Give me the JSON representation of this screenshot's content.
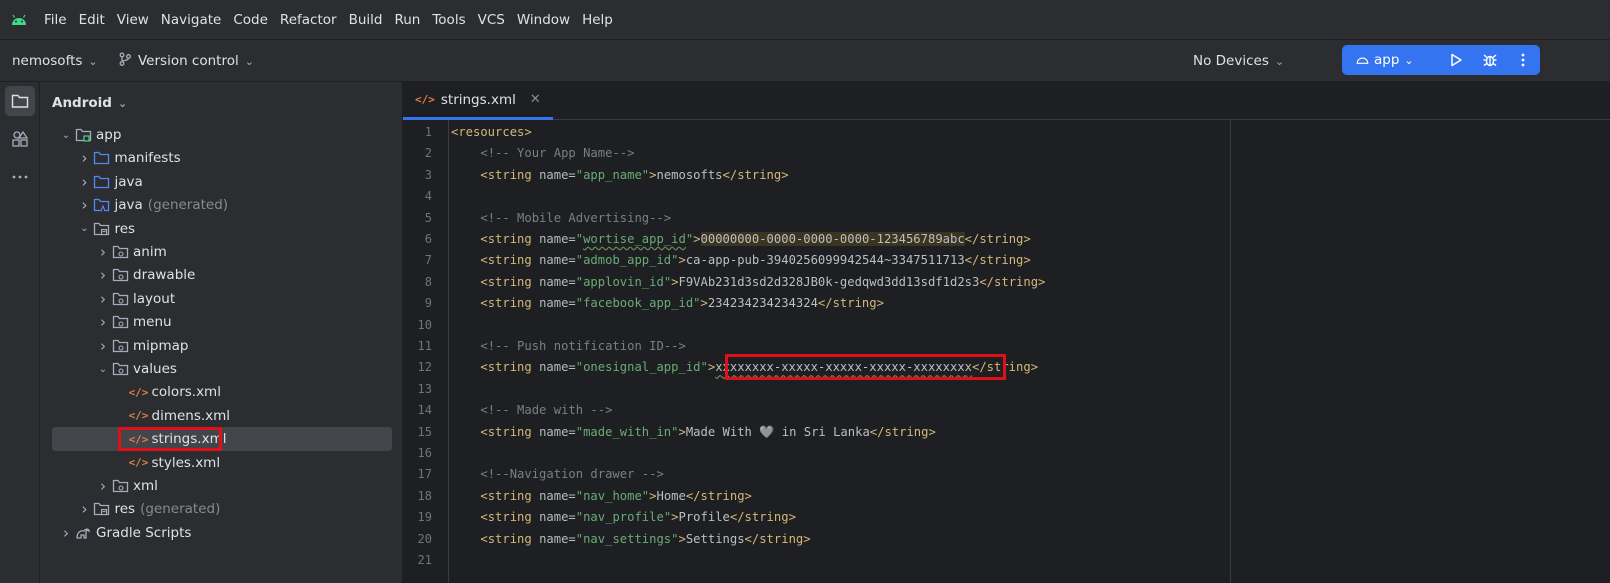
{
  "menubar": {
    "items": [
      "File",
      "Edit",
      "View",
      "Navigate",
      "Code",
      "Refactor",
      "Build",
      "Run",
      "Tools",
      "VCS",
      "Window",
      "Help"
    ]
  },
  "toolbar": {
    "project_name": "nemosofts",
    "vcs_label": "Version control",
    "device_label": "No Devices",
    "run_config": "app"
  },
  "project_panel": {
    "view_mode": "Android",
    "tree": [
      {
        "label": "app",
        "suffix": "",
        "icon": "module-folder-icon",
        "level": 0,
        "expanded": true
      },
      {
        "label": "manifests",
        "suffix": "",
        "icon": "folder-icon",
        "level": 1,
        "expanded": false
      },
      {
        "label": "java",
        "suffix": "",
        "icon": "folder-icon",
        "level": 1,
        "expanded": false
      },
      {
        "label": "java",
        "suffix": "(generated)",
        "icon": "generated-folder-icon",
        "level": 1,
        "expanded": false
      },
      {
        "label": "res",
        "suffix": "",
        "icon": "resource-folder-icon",
        "level": 1,
        "expanded": true
      },
      {
        "label": "anim",
        "suffix": "",
        "icon": "package-folder-icon",
        "level": 2,
        "expanded": false
      },
      {
        "label": "drawable",
        "suffix": "",
        "icon": "package-folder-icon",
        "level": 2,
        "expanded": false
      },
      {
        "label": "layout",
        "suffix": "",
        "icon": "package-folder-icon",
        "level": 2,
        "expanded": false
      },
      {
        "label": "menu",
        "suffix": "",
        "icon": "package-folder-icon",
        "level": 2,
        "expanded": false
      },
      {
        "label": "mipmap",
        "suffix": "",
        "icon": "package-folder-icon",
        "level": 2,
        "expanded": false
      },
      {
        "label": "values",
        "suffix": "",
        "icon": "package-folder-icon",
        "level": 2,
        "expanded": true
      },
      {
        "label": "colors.xml",
        "suffix": "",
        "icon": "xml-file-icon",
        "level": 3,
        "expanded": null
      },
      {
        "label": "dimens.xml",
        "suffix": "",
        "icon": "xml-file-icon",
        "level": 3,
        "expanded": null
      },
      {
        "label": "strings.xml",
        "suffix": "",
        "icon": "xml-file-icon",
        "level": 3,
        "expanded": null,
        "selected": true
      },
      {
        "label": "styles.xml",
        "suffix": "",
        "icon": "xml-file-icon",
        "level": 3,
        "expanded": null
      },
      {
        "label": "xml",
        "suffix": "",
        "icon": "package-folder-icon",
        "level": 2,
        "expanded": false
      },
      {
        "label": "res",
        "suffix": "(generated)",
        "icon": "resource-folder-icon",
        "level": 1,
        "expanded": false
      },
      {
        "label": "Gradle Scripts",
        "suffix": "",
        "icon": "gradle-icon",
        "level": 0,
        "expanded": false
      }
    ]
  },
  "editor": {
    "tab_label": "strings.xml",
    "line_numbers": [
      "1",
      "2",
      "3",
      "4",
      "5",
      "6",
      "7",
      "8",
      "9",
      "10",
      "11",
      "12",
      "13",
      "14",
      "15",
      "16",
      "17",
      "18",
      "19",
      "20",
      "21"
    ],
    "lines": [
      {
        "kind": "open",
        "tag": "<resources>"
      },
      {
        "kind": "comment",
        "text": "<!-- Your App Name-->"
      },
      {
        "kind": "string",
        "name": "app_name",
        "value": "nemosofts"
      },
      {
        "kind": "blank"
      },
      {
        "kind": "comment",
        "text": "<!-- Mobile Advertising-->"
      },
      {
        "kind": "string",
        "name": "wortise_app_id",
        "value": "00000000-0000-0000-0000-123456789abc"
      },
      {
        "kind": "string",
        "name": "admob_app_id",
        "value": "ca-app-pub-3940256099942544~3347511713"
      },
      {
        "kind": "string",
        "name": "applovin_id",
        "value": "F9VAb231d3sd2d328JB0k-gedqwd3dd13sdf1d2s3"
      },
      {
        "kind": "string",
        "name": "facebook_app_id",
        "value": "234234234234324"
      },
      {
        "kind": "blank"
      },
      {
        "kind": "comment",
        "text": "<!-- Push notification ID-->"
      },
      {
        "kind": "string",
        "name": "onesignal_app_id",
        "value": "xxxxxxxx-xxxxx-xxxxx-xxxxx-xxxxxxxx"
      },
      {
        "kind": "blank"
      },
      {
        "kind": "comment",
        "text": "<!-- Made with -->"
      },
      {
        "kind": "string",
        "name": "made_with_in",
        "value": "Made With 🩶 in Sri Lanka"
      },
      {
        "kind": "blank"
      },
      {
        "kind": "comment",
        "text": "<!--Navigation drawer -->"
      },
      {
        "kind": "string",
        "name": "nav_home",
        "value": "Home"
      },
      {
        "kind": "string",
        "name": "nav_profile",
        "value": "Profile"
      },
      {
        "kind": "string",
        "name": "nav_settings",
        "value": "Settings"
      },
      {
        "kind": "blank"
      }
    ]
  },
  "colors": {
    "accent": "#3574f0",
    "highlight_box": "#e0101a"
  }
}
